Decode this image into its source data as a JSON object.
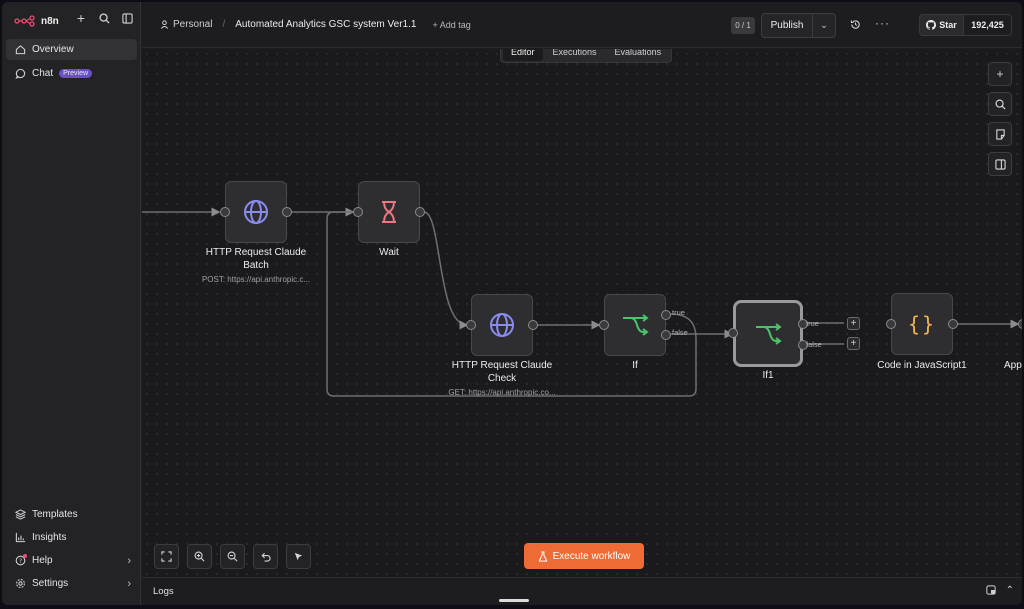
{
  "app": {
    "name": "n8n"
  },
  "sidebar": {
    "items": [
      {
        "label": "Overview",
        "icon": "home-icon",
        "active": true
      },
      {
        "label": "Chat",
        "icon": "chat-icon",
        "badge": "Preview"
      }
    ],
    "bottom_items": [
      {
        "label": "Templates",
        "icon": "templates-icon"
      },
      {
        "label": "Insights",
        "icon": "insights-icon"
      },
      {
        "label": "Help",
        "icon": "help-icon"
      },
      {
        "label": "Settings",
        "icon": "settings-icon"
      }
    ]
  },
  "header": {
    "project": "Personal",
    "workflow_title": "Automated Analytics GSC system Ver1.1",
    "add_tag": "+ Add tag",
    "counter": "0 / 1",
    "publish_label": "Publish",
    "github": {
      "star_label": "Star",
      "count": "192,425"
    }
  },
  "tabs": [
    {
      "label": "Editor",
      "active": true
    },
    {
      "label": "Executions"
    },
    {
      "label": "Evaluations"
    }
  ],
  "nodes": {
    "http_batch": {
      "title": "HTTP Request Claude Batch",
      "subtitle": "POST: https://api.anthropic.c...",
      "icon": "globe-icon"
    },
    "wait": {
      "title": "Wait",
      "icon": "hourglass-icon"
    },
    "http_check": {
      "title": "HTTP Request Claude Check",
      "subtitle": "GET: https://api.anthropic.co...",
      "icon": "globe-icon"
    },
    "if": {
      "title": "If",
      "icon": "branch-icon",
      "outputs": [
        "true",
        "false"
      ]
    },
    "if1": {
      "title": "If1",
      "icon": "branch-icon",
      "outputs": [
        "true",
        "false"
      ]
    },
    "code": {
      "title": "Code in JavaScript1",
      "icon": "code-braces-icon"
    },
    "append": {
      "title": "App"
    }
  },
  "execute_label": "Execute workflow",
  "logs_label": "Logs",
  "colors": {
    "accent": "#ef6b35",
    "true_branch": "#4cc36b",
    "globe": "#8a8cf0",
    "wait": "#ef7580",
    "code": "#f0b454"
  }
}
